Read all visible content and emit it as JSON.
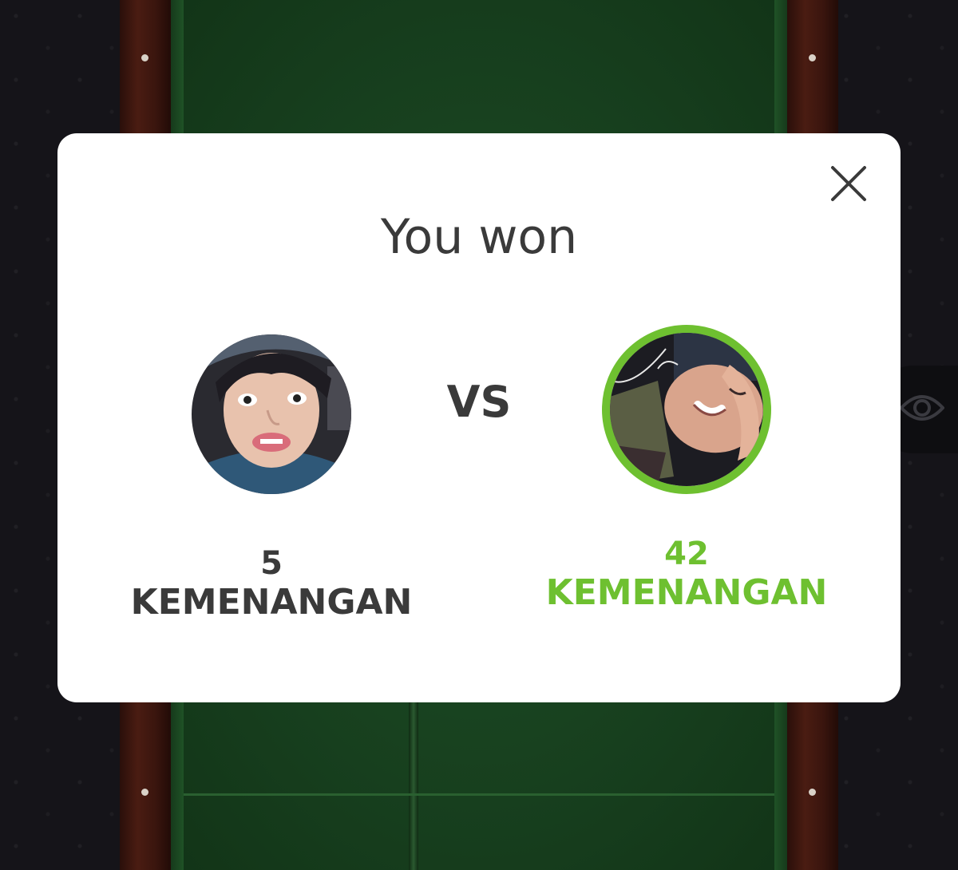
{
  "dialog": {
    "title": "You won",
    "vs_label": "VS",
    "close_icon": "close-icon"
  },
  "players": [
    {
      "wins": "5",
      "wins_label": "KEMENANGAN",
      "highlighted": false,
      "color": "#3a3a3a"
    },
    {
      "wins": "42",
      "wins_label": "KEMENANGAN",
      "highlighted": true,
      "color": "#6ec030"
    }
  ],
  "background": {
    "eye_icon": "eye-icon"
  },
  "colors": {
    "accent": "#6ec030",
    "text": "#3a3a3a",
    "felt": "#1d4f25",
    "rail": "#4a1c12"
  }
}
